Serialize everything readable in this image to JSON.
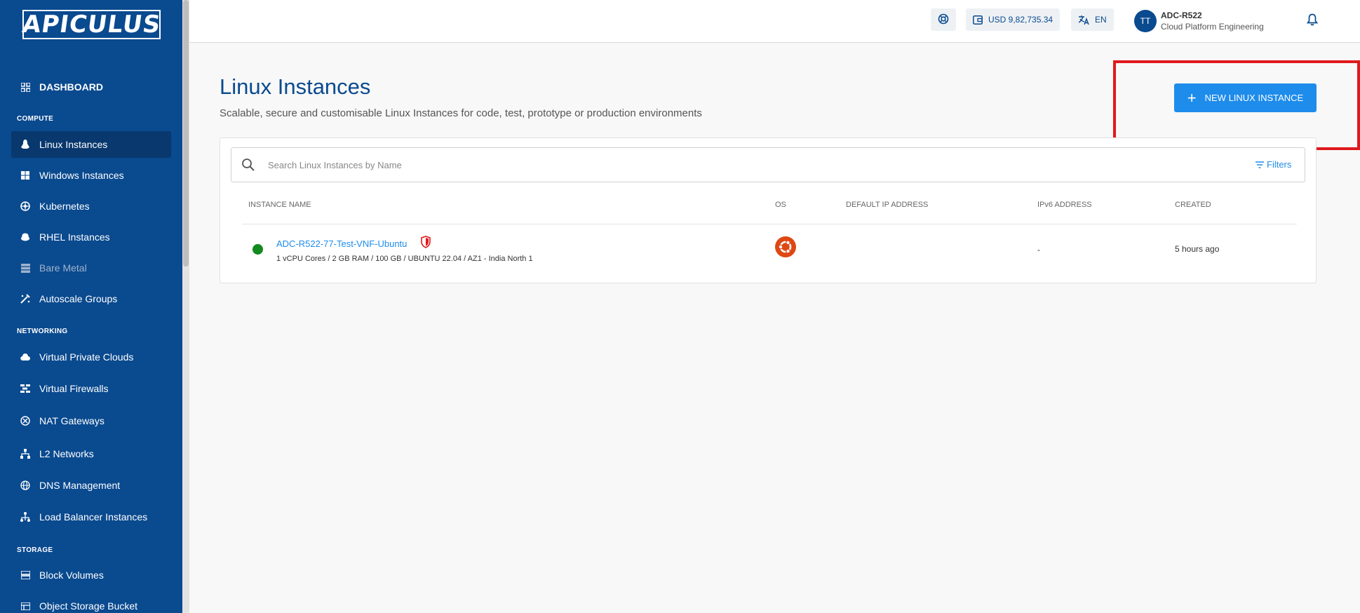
{
  "app": {
    "logo_text": "APICULUS"
  },
  "sidebar": {
    "dashboard": "DASHBOARD",
    "sections": {
      "compute": "COMPUTE",
      "networking": "NETWORKING",
      "storage": "STORAGE"
    },
    "compute_items": [
      {
        "label": "Linux Instances",
        "icon": "linux-icon",
        "active": true
      },
      {
        "label": "Windows Instances",
        "icon": "windows-icon"
      },
      {
        "label": "Kubernetes",
        "icon": "kubernetes-icon"
      },
      {
        "label": "RHEL Instances",
        "icon": "rhel-icon"
      },
      {
        "label": "Bare Metal",
        "icon": "server-icon",
        "disabled": true
      },
      {
        "label": "Autoscale Groups",
        "icon": "autoscale-icon"
      }
    ],
    "networking_items": [
      {
        "label": "Virtual Private Clouds",
        "icon": "cloud-icon"
      },
      {
        "label": "Virtual Firewalls",
        "icon": "firewall-icon"
      },
      {
        "label": "NAT Gateways",
        "icon": "gateway-icon"
      },
      {
        "label": "L2 Networks",
        "icon": "network-icon"
      },
      {
        "label": "DNS Management",
        "icon": "globe-icon"
      },
      {
        "label": "Load Balancer Instances",
        "icon": "load-balancer-icon"
      }
    ],
    "storage_items": [
      {
        "label": "Block Volumes",
        "icon": "block-volume-icon"
      },
      {
        "label": "Object Storage Bucket",
        "icon": "bucket-icon"
      }
    ]
  },
  "topbar": {
    "balance": "USD 9,82,735.34",
    "language": "EN",
    "avatar_initials": "TT",
    "user_name": "ADC-R522",
    "user_org": "Cloud Platform Engineering"
  },
  "main": {
    "title": "Linux Instances",
    "subtitle": "Scalable, secure and customisable Linux Instances for code, test, prototype or production environments",
    "new_button": "NEW LINUX INSTANCE",
    "search_placeholder": "Search Linux Instances by Name",
    "filters_label": "Filters",
    "columns": [
      "INSTANCE NAME",
      "OS",
      "DEFAULT IP ADDRESS",
      "IPv6 ADDRESS",
      "CREATED"
    ],
    "rows": [
      {
        "name": "ADC-R522-77-Test-VNF-Ubuntu",
        "spec": "1 vCPU Cores / 2 GB RAM / 100 GB / UBUNTU 22.04 / AZ1 - India North 1",
        "os": "ubuntu-icon",
        "default_ip": "",
        "ipv6": "-",
        "created": "5 hours ago",
        "status_color": "#128a1e"
      }
    ]
  },
  "colors": {
    "sidebar": "#0a4a8f",
    "accent": "#1e8ceb",
    "highlight": "#e0191c"
  }
}
